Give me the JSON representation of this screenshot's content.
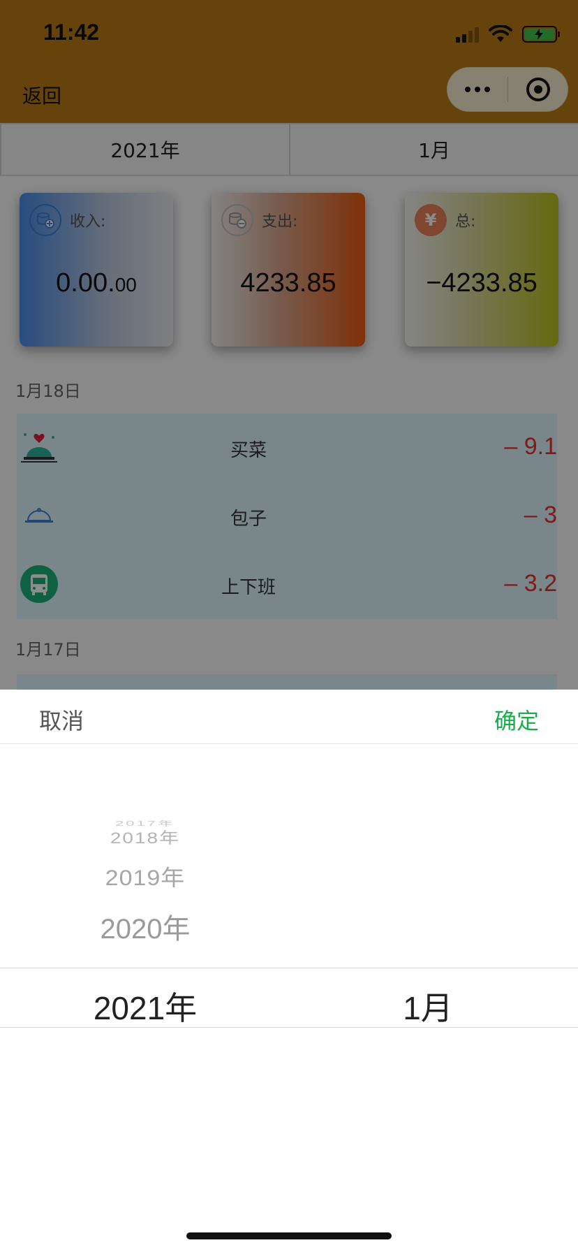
{
  "status_bar": {
    "time": "11:42"
  },
  "navbar": {
    "back_label": "返回"
  },
  "period_selector": {
    "year": "2021年",
    "month": "1月"
  },
  "summary_cards": {
    "income": {
      "label": "收入:",
      "value_main": "0.00.",
      "value_small": "00"
    },
    "expense": {
      "label": "支出:",
      "value": "4233.85"
    },
    "total": {
      "label": "总:",
      "value": "−4233.85",
      "icon_glyph": "¥"
    }
  },
  "days": [
    {
      "date": "1月18日",
      "records": [
        {
          "name": "买菜",
          "amount": "– 9.1",
          "icon": "dining-icon"
        },
        {
          "name": "包子",
          "amount": "– 3",
          "icon": "food-cover-icon"
        },
        {
          "name": "上下班",
          "amount": "– 3.2",
          "icon": "bus-icon"
        }
      ]
    },
    {
      "date": "1月17日",
      "records": []
    }
  ],
  "picker": {
    "cancel_label": "取消",
    "confirm_label": "确定",
    "years": [
      "2017年",
      "2018年",
      "2019年",
      "2020年",
      "2021年"
    ],
    "selected_year": "2021年",
    "selected_month": "1月"
  },
  "colors": {
    "header_bg": "#b87b14",
    "confirm_green": "#1aad4b",
    "expense_red": "#e8302c",
    "record_bg": "#dff6fb"
  }
}
